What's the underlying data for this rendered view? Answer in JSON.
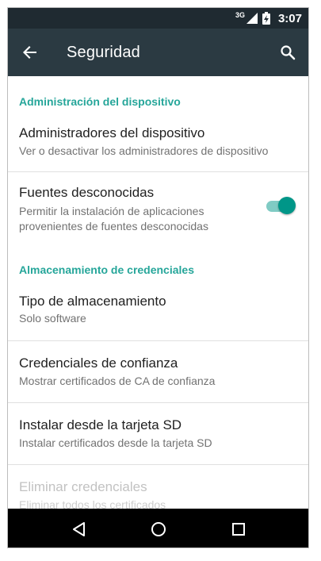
{
  "status_bar": {
    "network": "3G",
    "time": "3:07"
  },
  "app_bar": {
    "title": "Seguridad",
    "back_icon": "arrow-back-icon",
    "search_icon": "search-icon"
  },
  "sections": {
    "device_admin": {
      "header": "Administración del dispositivo",
      "items": [
        {
          "title": "Administradores del dispositivo",
          "summary": "Ver o desactivar los administradores de dispositivo"
        },
        {
          "title": "Fuentes desconocidas",
          "summary": "Permitir la instalación de aplicaciones provenientes de fuentes desconocidas",
          "toggle_on": true
        }
      ]
    },
    "credentials": {
      "header": "Almacenamiento de credenciales",
      "items": [
        {
          "title": "Tipo de almacenamiento",
          "summary": "Solo software"
        },
        {
          "title": "Credenciales de confianza",
          "summary": "Mostrar certificados de CA de confianza"
        },
        {
          "title": "Instalar desde la tarjeta SD",
          "summary": "Instalar certificados desde la tarjeta SD"
        },
        {
          "title": "Eliminar credenciales",
          "summary": "Eliminar todos los certificados",
          "disabled": true
        }
      ]
    }
  },
  "nav_bar": {
    "back_icon": "nav-back-icon",
    "home_icon": "nav-home-icon",
    "recents_icon": "nav-recents-icon"
  },
  "colors": {
    "accent": "#26a69a",
    "app_bar": "#2b3a42",
    "status_bar": "#1f2a31"
  }
}
